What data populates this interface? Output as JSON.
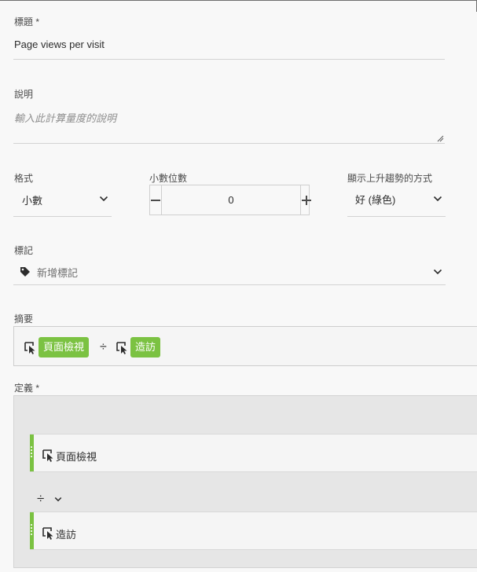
{
  "title_field": {
    "label": "標題 *",
    "value": "Page views per visit"
  },
  "description_field": {
    "label": "說明",
    "placeholder": "輸入此計算量度的說明"
  },
  "format": {
    "label": "格式",
    "value": "小數"
  },
  "decimal_places": {
    "label": "小數位數",
    "value": "0"
  },
  "trend": {
    "label": "顯示上升趨勢的方式",
    "value": "好 (綠色)"
  },
  "tags": {
    "label": "標記",
    "placeholder": "新增標記"
  },
  "summary": {
    "label": "摘要",
    "operator": "÷",
    "metrics": [
      "頁面檢視",
      "造訪"
    ]
  },
  "definition": {
    "label": "定義 *",
    "items": [
      {
        "label": "頁面檢視"
      },
      {
        "label": "造訪"
      }
    ],
    "operator": "÷"
  },
  "colors": {
    "metric_pill": "#7bc242",
    "accent_bar": "#7bc242"
  },
  "icons": [
    "chevron-down-icon",
    "minus-icon",
    "plus-icon",
    "tag-icon",
    "metric-icon",
    "resize-handle-icon"
  ]
}
